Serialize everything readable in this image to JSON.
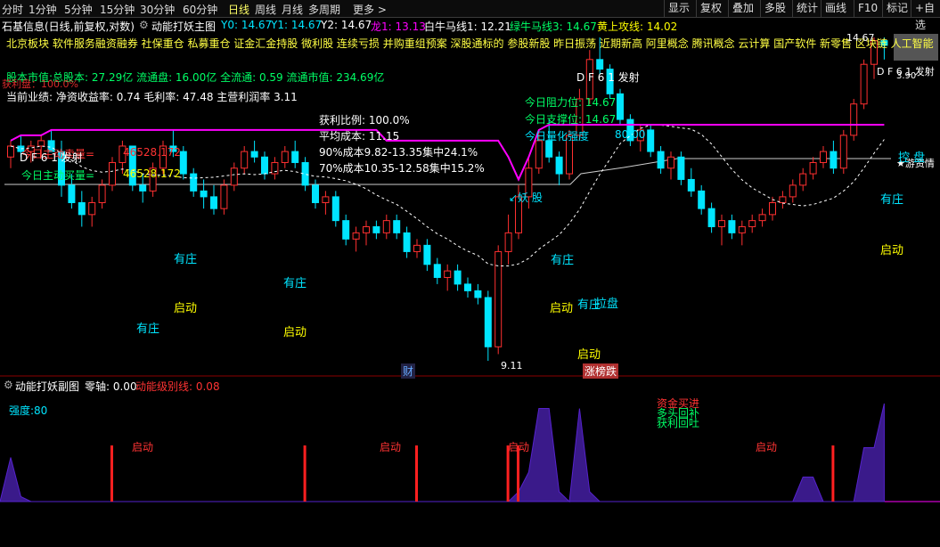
{
  "toolbar": {
    "timeframes": [
      "分时",
      "1分钟",
      "5分钟",
      "15分钟",
      "30分钟",
      "60分钟",
      "日线",
      "周线",
      "月线",
      "多周期",
      "更多 >"
    ],
    "active_index": 6,
    "right": [
      "显示",
      "复权",
      "叠加",
      "多股",
      "统计",
      "画线",
      "F10",
      "标记",
      "+自选"
    ]
  },
  "title": {
    "stock": "石基信息(日线,前复权,对数)",
    "indicator": "动能打妖主图",
    "y0": "Y0: 14.67",
    "y1": "Y1: 14.67",
    "y2": "Y2: 14.67",
    "dragon": "龙1: 13.13",
    "bull": "白牛马线1: 12.21",
    "green_bull": "绿牛马线3: 14.67",
    "yellow": "黄上攻线: 14.02"
  },
  "info": {
    "concepts": "北京板块  软件服务融资融券 社保重仓 私募重仓 证金汇金持股 微利股 连续亏损 并购重组预案 深股通标的 参股新股 昨日振荡 近期新高  阿里概念 腾讯概念 云计算 国产软件 新零售 区块链 人工智能",
    "market_value": "股本市值:总股本: 27.29亿 流通盘: 16.00亿 全流通: 0.59 流通市值: 234.69亿",
    "profit_overlay": "获利盘：100.0%",
    "performance": "当前业绩:  净资收益率: 0.74 毛利率: 47.48 主营利润率 3.11",
    "chip": {
      "profit_ratio": "获利比例: 100.0%",
      "avg_cost": "平均成本: 11.15",
      "c90": "90%成本9.82-13.35集中24.1%",
      "c70": "70%成本10.35-12.58集中15.2%"
    },
    "active_buy_label": "今日主动买量=",
    "active_buy_value": "46528.172",
    "active_sell_label": "今日主动卖量=",
    "active_sell_value": "46528.172",
    "df61_left": "D F 6 1 发射",
    "df61_mid": "D F 6 1 发射",
    "df61_right": "D F 6 1 发射",
    "resistance": "今日阻力位: 14.67",
    "support": "今日支撑位: 14.67",
    "strength_label": "今日量化强度",
    "strength_value": "80.00",
    "price_top": "14.67",
    "price_right": "3.90",
    "price_low": "9.11",
    "demon": "↙妖 股",
    "swim": "★游资情",
    "tag_cai": "财",
    "tag_zhang": "涨榜跌"
  },
  "labels": [
    {
      "t": "有庄",
      "c": "c"
    },
    {
      "t": "启动",
      "c": "y"
    },
    {
      "t": "有庄",
      "c": "c"
    },
    {
      "t": "有庄",
      "c": "c"
    },
    {
      "t": "启动",
      "c": "y"
    },
    {
      "t": "有庄",
      "c": "c"
    },
    {
      "t": "启动",
      "c": "y"
    },
    {
      "t": "有庄",
      "c": "c"
    },
    {
      "t": "拉盘",
      "c": "c"
    },
    {
      "t": "启动",
      "c": "y"
    },
    {
      "t": "有庄",
      "c": "c"
    },
    {
      "t": "启动",
      "c": "y"
    },
    {
      "t": "控 盘",
      "c": "c"
    }
  ],
  "sub": {
    "title": "动能打妖副图",
    "zero": "零轴: 0.00",
    "level": "动能级别线: 0.08",
    "strength": "强度:80",
    "launch": "启动",
    "signals": [
      "资金买进",
      "多头回补",
      "获利回吐"
    ]
  },
  "colors": {
    "up": "#ff3030",
    "down": "#00e5ff",
    "magenta": "#ff00ff",
    "yellow": "#ffff00",
    "sub_fill": "#3a1a8a"
  },
  "chart_data": {
    "type": "candlestick",
    "y_range": [
      9.11,
      14.67
    ],
    "series": [
      {
        "name": "K",
        "values": [
          [
            12.3,
            12.6,
            12.1,
            12.5
          ],
          [
            12.5,
            12.7,
            12.3,
            12.4
          ],
          [
            12.4,
            12.6,
            12.2,
            12.5
          ],
          [
            12.5,
            12.7,
            12.3,
            12.6
          ],
          [
            12.6,
            12.8,
            12.4,
            12.4
          ],
          [
            12.4,
            12.6,
            11.6,
            11.8
          ],
          [
            11.8,
            12.0,
            11.4,
            11.5
          ],
          [
            11.5,
            11.7,
            11.1,
            11.3
          ],
          [
            11.3,
            11.6,
            11.1,
            11.5
          ],
          [
            11.5,
            11.9,
            11.4,
            11.8
          ],
          [
            11.8,
            12.3,
            11.7,
            12.2
          ],
          [
            12.2,
            12.6,
            12.0,
            12.5
          ],
          [
            12.5,
            12.5,
            11.7,
            11.8
          ],
          [
            11.8,
            12.0,
            11.5,
            11.7
          ],
          [
            11.7,
            12.2,
            11.6,
            12.1
          ],
          [
            12.1,
            12.6,
            12.0,
            12.5
          ],
          [
            12.5,
            12.8,
            12.3,
            12.4
          ],
          [
            12.4,
            12.5,
            11.9,
            12.0
          ],
          [
            12.0,
            12.1,
            11.6,
            11.7
          ],
          [
            11.7,
            11.9,
            11.4,
            11.6
          ],
          [
            11.6,
            11.8,
            11.3,
            11.4
          ],
          [
            11.4,
            11.9,
            11.3,
            11.8
          ],
          [
            11.8,
            12.2,
            11.7,
            12.1
          ],
          [
            12.1,
            12.5,
            12.0,
            12.4
          ],
          [
            12.4,
            12.6,
            12.2,
            12.3
          ],
          [
            12.3,
            12.4,
            11.9,
            12.0
          ],
          [
            12.0,
            12.3,
            11.9,
            12.2
          ],
          [
            12.2,
            12.5,
            12.1,
            12.4
          ],
          [
            12.4,
            12.6,
            12.1,
            12.2
          ],
          [
            12.2,
            12.3,
            11.7,
            11.8
          ],
          [
            11.8,
            11.9,
            11.4,
            11.5
          ],
          [
            11.5,
            11.7,
            11.3,
            11.6
          ],
          [
            11.6,
            11.7,
            11.1,
            11.2
          ],
          [
            11.2,
            11.3,
            10.8,
            10.9
          ],
          [
            10.9,
            11.1,
            10.7,
            11.0
          ],
          [
            11.0,
            11.2,
            10.8,
            11.1
          ],
          [
            11.1,
            11.2,
            10.9,
            11.0
          ],
          [
            11.0,
            11.3,
            10.9,
            11.2
          ],
          [
            11.2,
            11.3,
            10.9,
            11.0
          ],
          [
            11.0,
            11.1,
            10.6,
            10.7
          ],
          [
            10.7,
            10.9,
            10.6,
            10.8
          ],
          [
            10.8,
            10.9,
            10.4,
            10.5
          ],
          [
            10.5,
            10.6,
            10.2,
            10.3
          ],
          [
            10.3,
            10.5,
            10.1,
            10.4
          ],
          [
            10.4,
            10.5,
            10.1,
            10.2
          ],
          [
            10.2,
            10.3,
            10.0,
            10.1
          ],
          [
            10.1,
            10.2,
            9.9,
            10.0
          ],
          [
            10.0,
            10.1,
            9.11,
            9.3
          ],
          [
            9.3,
            10.8,
            9.2,
            10.7
          ],
          [
            10.7,
            11.3,
            10.5,
            11.0
          ],
          [
            11.0,
            11.8,
            10.9,
            11.6
          ],
          [
            11.6,
            12.3,
            11.4,
            12.1
          ],
          [
            12.1,
            12.8,
            12.0,
            12.6
          ],
          [
            12.6,
            13.0,
            12.2,
            12.3
          ],
          [
            12.3,
            12.4,
            11.8,
            12.0
          ],
          [
            12.0,
            12.8,
            11.9,
            12.7
          ],
          [
            12.7,
            13.6,
            12.6,
            13.4
          ],
          [
            13.4,
            14.4,
            13.3,
            14.2
          ],
          [
            14.2,
            14.67,
            13.9,
            14.0
          ],
          [
            14.0,
            14.1,
            13.4,
            13.5
          ],
          [
            13.5,
            13.6,
            12.9,
            13.0
          ],
          [
            13.0,
            13.1,
            12.5,
            12.6
          ],
          [
            12.6,
            12.9,
            12.4,
            12.8
          ],
          [
            12.8,
            12.9,
            12.3,
            12.4
          ],
          [
            12.4,
            12.5,
            12.0,
            12.1
          ],
          [
            12.1,
            12.4,
            11.9,
            12.3
          ],
          [
            12.3,
            12.4,
            11.8,
            11.9
          ],
          [
            11.9,
            12.1,
            11.6,
            11.7
          ],
          [
            11.7,
            11.8,
            11.3,
            11.4
          ],
          [
            11.4,
            11.5,
            11.0,
            11.1
          ],
          [
            11.1,
            11.3,
            10.8,
            11.2
          ],
          [
            11.2,
            11.3,
            10.9,
            11.0
          ],
          [
            11.0,
            11.2,
            10.8,
            11.1
          ],
          [
            11.1,
            11.3,
            11.0,
            11.2
          ],
          [
            11.2,
            11.4,
            11.1,
            11.3
          ],
          [
            11.3,
            11.6,
            11.2,
            11.5
          ],
          [
            11.5,
            11.7,
            11.4,
            11.6
          ],
          [
            11.6,
            11.9,
            11.5,
            11.8
          ],
          [
            11.8,
            12.1,
            11.7,
            12.0
          ],
          [
            12.0,
            12.3,
            11.9,
            12.2
          ],
          [
            12.2,
            12.5,
            12.1,
            12.4
          ],
          [
            12.4,
            12.6,
            12.0,
            12.1
          ],
          [
            12.1,
            12.8,
            12.0,
            12.7
          ],
          [
            12.7,
            13.4,
            12.6,
            13.3
          ],
          [
            13.3,
            14.2,
            13.2,
            14.1
          ],
          [
            14.1,
            14.67,
            13.8,
            14.6
          ],
          [
            14.6,
            14.67,
            14.2,
            14.5
          ]
        ]
      }
    ],
    "sub_type": "area",
    "sub_values": [
      0.9,
      0.1,
      0,
      0,
      0,
      0,
      0,
      0,
      0,
      0,
      0,
      0,
      0,
      0,
      0,
      0,
      0,
      0,
      0,
      0,
      0,
      0,
      0,
      0,
      0,
      0,
      0,
      0,
      0,
      0,
      0,
      0,
      0,
      0,
      0,
      0,
      0,
      0,
      0,
      0,
      0,
      0,
      0,
      0,
      0,
      0,
      0,
      0,
      0,
      0,
      0.2,
      0.6,
      1.9,
      1.9,
      0.2,
      0,
      1.9,
      0.2,
      0,
      0,
      0,
      0,
      0,
      0,
      0,
      0,
      0,
      0,
      0,
      0,
      0,
      0,
      0,
      0,
      0,
      0,
      0,
      0,
      0.5,
      0.5,
      0,
      0,
      0,
      0,
      1.1,
      1.1,
      2.0
    ],
    "sub_spikes": [
      10,
      29,
      40,
      49,
      50,
      81
    ]
  }
}
